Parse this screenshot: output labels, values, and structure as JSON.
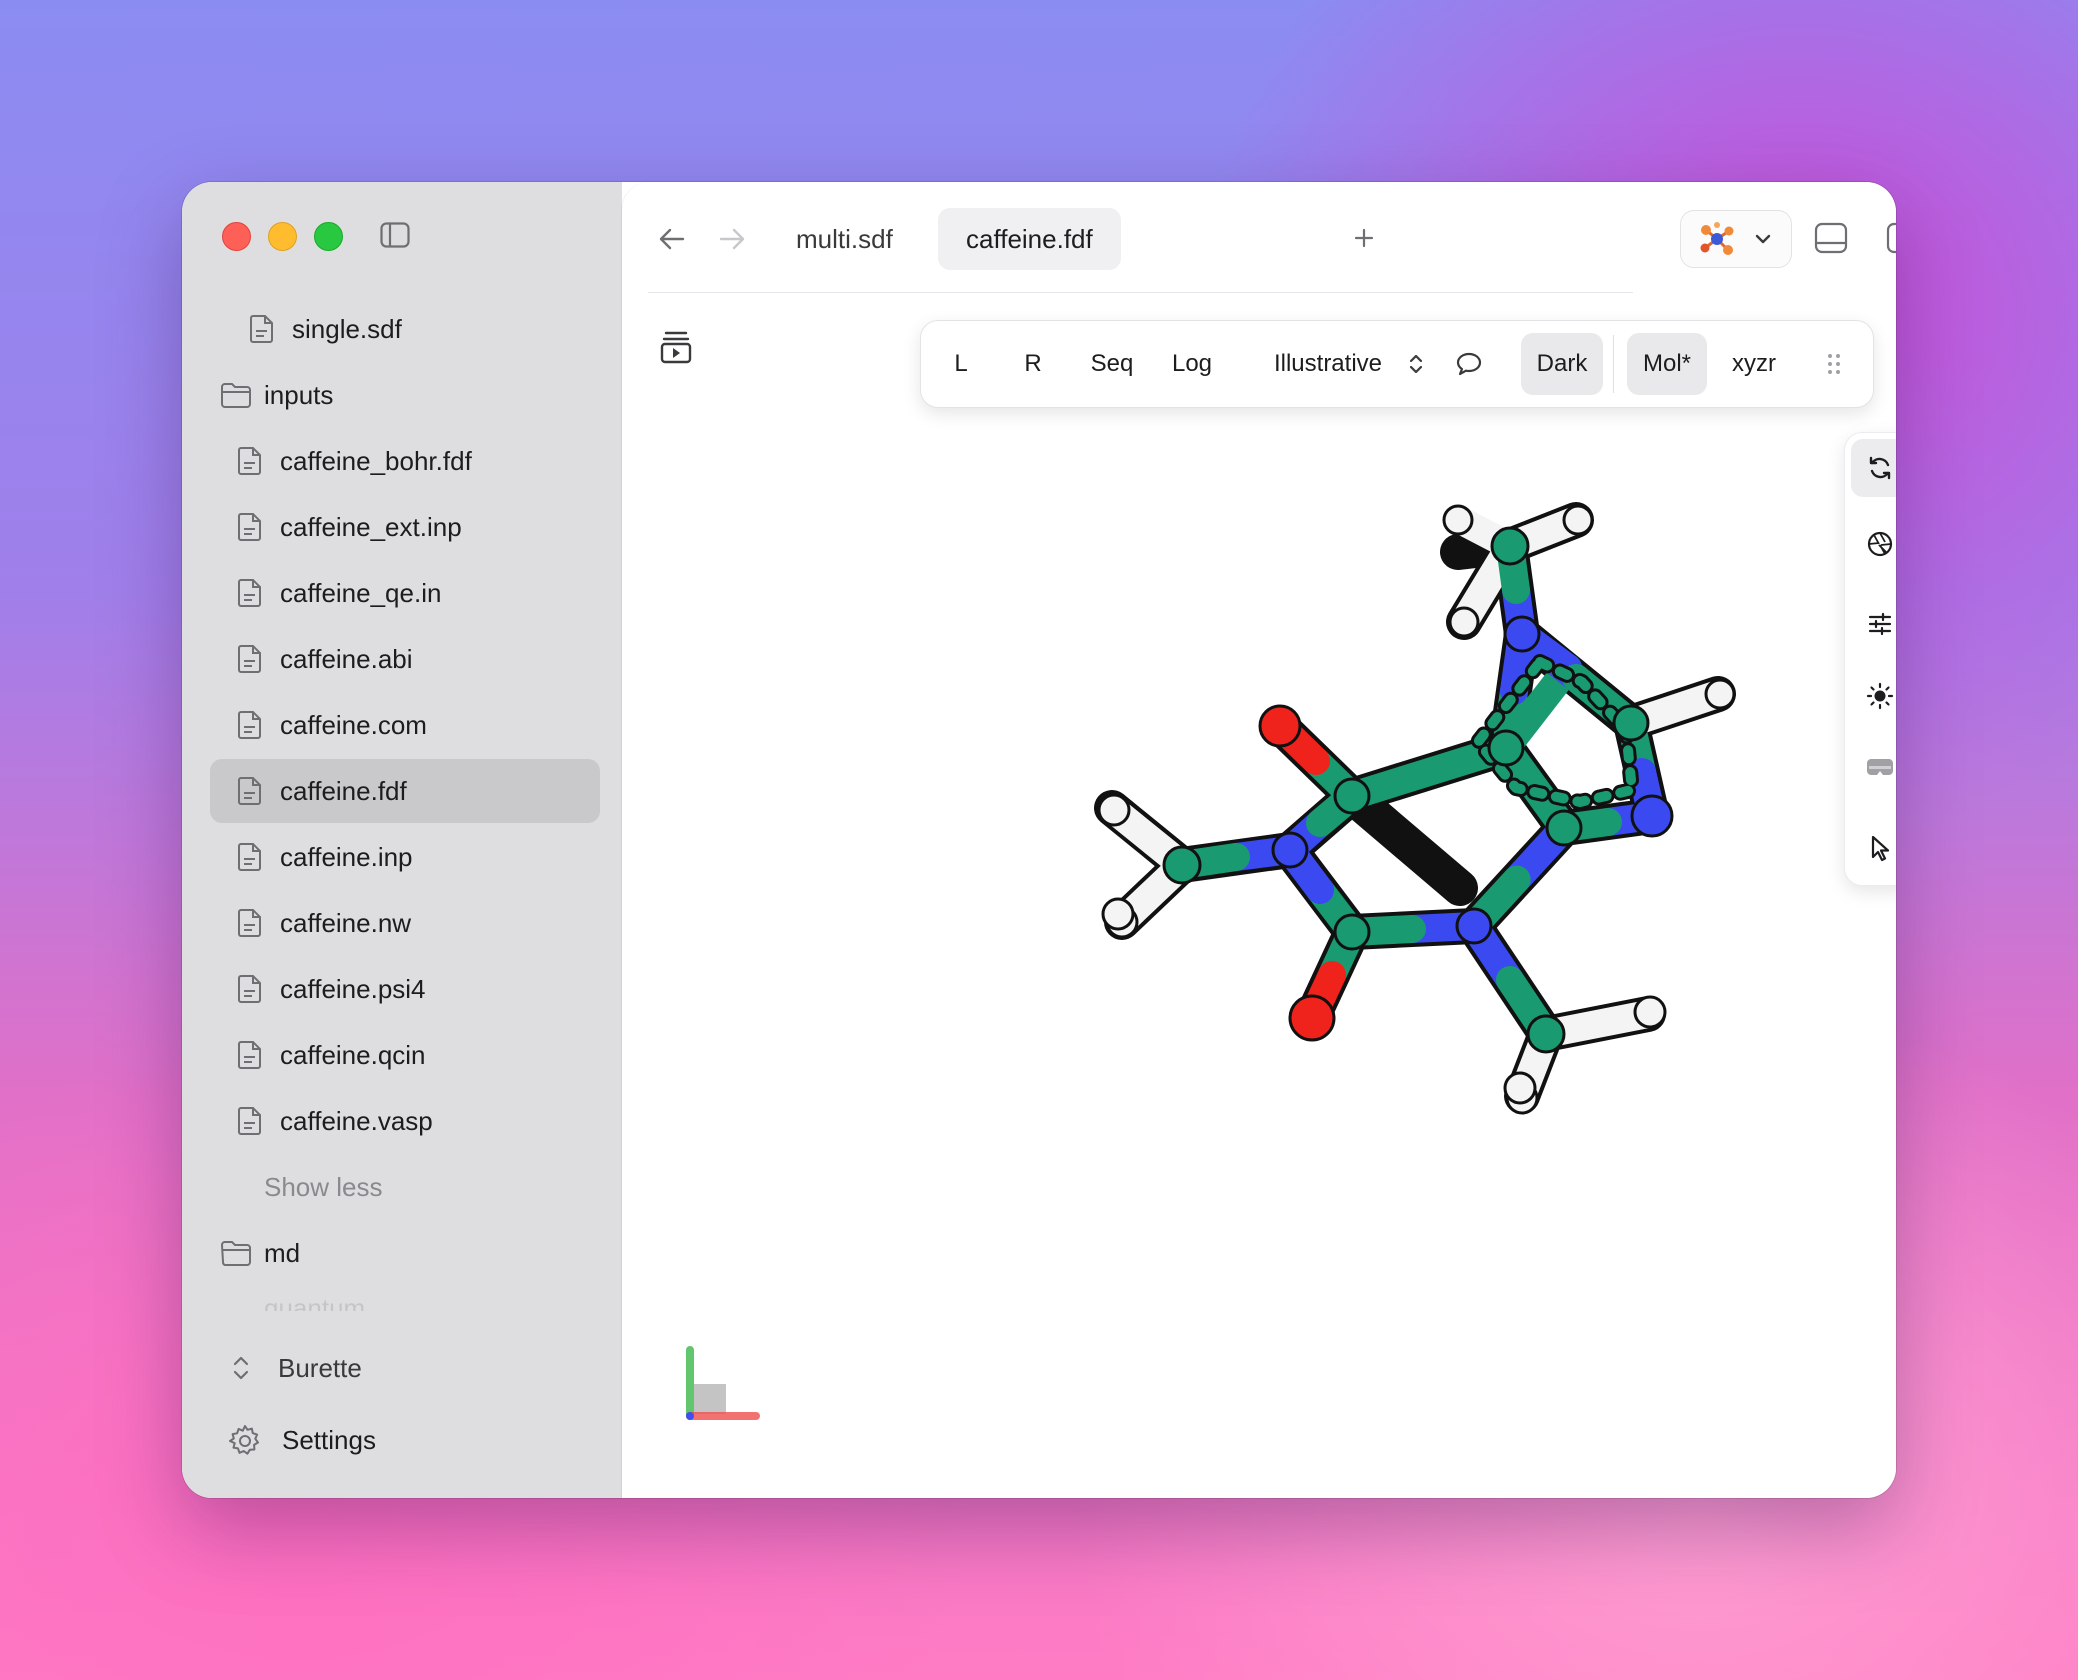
{
  "window": {
    "traffic_lights": [
      "close",
      "minimize",
      "zoom"
    ]
  },
  "sidebar": {
    "items": [
      {
        "label": "single.sdf",
        "icon": "file-icon",
        "type": "file"
      },
      {
        "label": "inputs",
        "icon": "folder-icon",
        "type": "folder"
      },
      {
        "label": "caffeine_bohr.fdf",
        "icon": "file-icon",
        "type": "file"
      },
      {
        "label": "caffeine_ext.inp",
        "icon": "file-icon",
        "type": "file"
      },
      {
        "label": "caffeine_qe.in",
        "icon": "file-icon",
        "type": "file"
      },
      {
        "label": "caffeine.abi",
        "icon": "file-icon",
        "type": "file"
      },
      {
        "label": "caffeine.com",
        "icon": "file-icon",
        "type": "file"
      },
      {
        "label": "caffeine.fdf",
        "icon": "file-icon",
        "type": "file",
        "selected": true
      },
      {
        "label": "caffeine.inp",
        "icon": "file-icon",
        "type": "file"
      },
      {
        "label": "caffeine.nw",
        "icon": "file-icon",
        "type": "file"
      },
      {
        "label": "caffeine.psi4",
        "icon": "file-icon",
        "type": "file"
      },
      {
        "label": "caffeine.qcin",
        "icon": "file-icon",
        "type": "file"
      },
      {
        "label": "caffeine.vasp",
        "icon": "file-icon",
        "type": "file"
      }
    ],
    "show_less": "Show less",
    "folder_md": "md",
    "folder_faded": "quantum",
    "workspace": "Burette",
    "settings": "Settings"
  },
  "tabs": [
    {
      "label": "multi.sdf",
      "active": false
    },
    {
      "label": "caffeine.fdf",
      "active": true
    }
  ],
  "toolbar": {
    "buttons": [
      "L",
      "R",
      "Seq",
      "Log",
      "Illustrative",
      "Dark",
      "Mol*",
      "xyzr"
    ],
    "active": [
      "Dark",
      "Mol*"
    ]
  },
  "side_tools": [
    "rotate-icon",
    "aperture-icon",
    "sliders-icon",
    "sun-icon",
    "vr-headset-icon",
    "cursor-icon"
  ],
  "colors": {
    "carbon": "#1a9a70",
    "nitrogen": "#3a4af0",
    "oxygen": "#f0221c",
    "hydrogen": "#f4f4f4",
    "accent": "#e06a2a"
  }
}
